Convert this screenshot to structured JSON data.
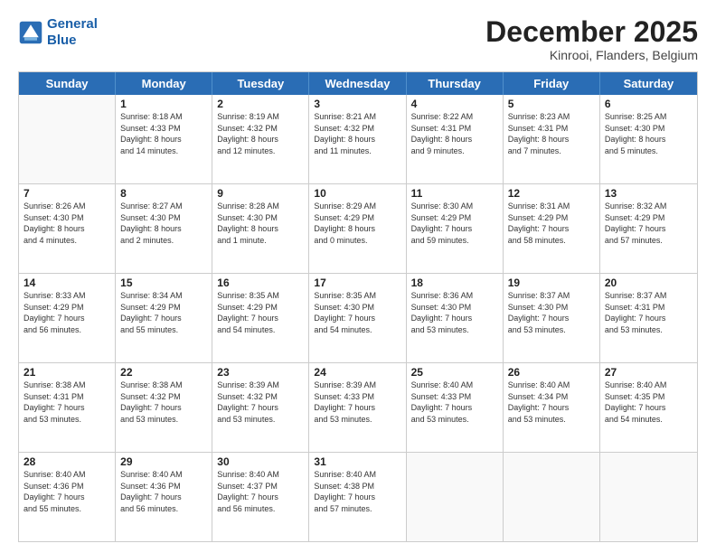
{
  "logo": {
    "line1": "General",
    "line2": "Blue"
  },
  "title": "December 2025",
  "location": "Kinrooi, Flanders, Belgium",
  "days_header": [
    "Sunday",
    "Monday",
    "Tuesday",
    "Wednesday",
    "Thursday",
    "Friday",
    "Saturday"
  ],
  "weeks": [
    [
      {
        "day": "",
        "info": ""
      },
      {
        "day": "1",
        "info": "Sunrise: 8:18 AM\nSunset: 4:33 PM\nDaylight: 8 hours\nand 14 minutes."
      },
      {
        "day": "2",
        "info": "Sunrise: 8:19 AM\nSunset: 4:32 PM\nDaylight: 8 hours\nand 12 minutes."
      },
      {
        "day": "3",
        "info": "Sunrise: 8:21 AM\nSunset: 4:32 PM\nDaylight: 8 hours\nand 11 minutes."
      },
      {
        "day": "4",
        "info": "Sunrise: 8:22 AM\nSunset: 4:31 PM\nDaylight: 8 hours\nand 9 minutes."
      },
      {
        "day": "5",
        "info": "Sunrise: 8:23 AM\nSunset: 4:31 PM\nDaylight: 8 hours\nand 7 minutes."
      },
      {
        "day": "6",
        "info": "Sunrise: 8:25 AM\nSunset: 4:30 PM\nDaylight: 8 hours\nand 5 minutes."
      }
    ],
    [
      {
        "day": "7",
        "info": "Sunrise: 8:26 AM\nSunset: 4:30 PM\nDaylight: 8 hours\nand 4 minutes."
      },
      {
        "day": "8",
        "info": "Sunrise: 8:27 AM\nSunset: 4:30 PM\nDaylight: 8 hours\nand 2 minutes."
      },
      {
        "day": "9",
        "info": "Sunrise: 8:28 AM\nSunset: 4:30 PM\nDaylight: 8 hours\nand 1 minute."
      },
      {
        "day": "10",
        "info": "Sunrise: 8:29 AM\nSunset: 4:29 PM\nDaylight: 8 hours\nand 0 minutes."
      },
      {
        "day": "11",
        "info": "Sunrise: 8:30 AM\nSunset: 4:29 PM\nDaylight: 7 hours\nand 59 minutes."
      },
      {
        "day": "12",
        "info": "Sunrise: 8:31 AM\nSunset: 4:29 PM\nDaylight: 7 hours\nand 58 minutes."
      },
      {
        "day": "13",
        "info": "Sunrise: 8:32 AM\nSunset: 4:29 PM\nDaylight: 7 hours\nand 57 minutes."
      }
    ],
    [
      {
        "day": "14",
        "info": "Sunrise: 8:33 AM\nSunset: 4:29 PM\nDaylight: 7 hours\nand 56 minutes."
      },
      {
        "day": "15",
        "info": "Sunrise: 8:34 AM\nSunset: 4:29 PM\nDaylight: 7 hours\nand 55 minutes."
      },
      {
        "day": "16",
        "info": "Sunrise: 8:35 AM\nSunset: 4:29 PM\nDaylight: 7 hours\nand 54 minutes."
      },
      {
        "day": "17",
        "info": "Sunrise: 8:35 AM\nSunset: 4:30 PM\nDaylight: 7 hours\nand 54 minutes."
      },
      {
        "day": "18",
        "info": "Sunrise: 8:36 AM\nSunset: 4:30 PM\nDaylight: 7 hours\nand 53 minutes."
      },
      {
        "day": "19",
        "info": "Sunrise: 8:37 AM\nSunset: 4:30 PM\nDaylight: 7 hours\nand 53 minutes."
      },
      {
        "day": "20",
        "info": "Sunrise: 8:37 AM\nSunset: 4:31 PM\nDaylight: 7 hours\nand 53 minutes."
      }
    ],
    [
      {
        "day": "21",
        "info": "Sunrise: 8:38 AM\nSunset: 4:31 PM\nDaylight: 7 hours\nand 53 minutes."
      },
      {
        "day": "22",
        "info": "Sunrise: 8:38 AM\nSunset: 4:32 PM\nDaylight: 7 hours\nand 53 minutes."
      },
      {
        "day": "23",
        "info": "Sunrise: 8:39 AM\nSunset: 4:32 PM\nDaylight: 7 hours\nand 53 minutes."
      },
      {
        "day": "24",
        "info": "Sunrise: 8:39 AM\nSunset: 4:33 PM\nDaylight: 7 hours\nand 53 minutes."
      },
      {
        "day": "25",
        "info": "Sunrise: 8:40 AM\nSunset: 4:33 PM\nDaylight: 7 hours\nand 53 minutes."
      },
      {
        "day": "26",
        "info": "Sunrise: 8:40 AM\nSunset: 4:34 PM\nDaylight: 7 hours\nand 53 minutes."
      },
      {
        "day": "27",
        "info": "Sunrise: 8:40 AM\nSunset: 4:35 PM\nDaylight: 7 hours\nand 54 minutes."
      }
    ],
    [
      {
        "day": "28",
        "info": "Sunrise: 8:40 AM\nSunset: 4:36 PM\nDaylight: 7 hours\nand 55 minutes."
      },
      {
        "day": "29",
        "info": "Sunrise: 8:40 AM\nSunset: 4:36 PM\nDaylight: 7 hours\nand 56 minutes."
      },
      {
        "day": "30",
        "info": "Sunrise: 8:40 AM\nSunset: 4:37 PM\nDaylight: 7 hours\nand 56 minutes."
      },
      {
        "day": "31",
        "info": "Sunrise: 8:40 AM\nSunset: 4:38 PM\nDaylight: 7 hours\nand 57 minutes."
      },
      {
        "day": "",
        "info": ""
      },
      {
        "day": "",
        "info": ""
      },
      {
        "day": "",
        "info": ""
      }
    ]
  ]
}
